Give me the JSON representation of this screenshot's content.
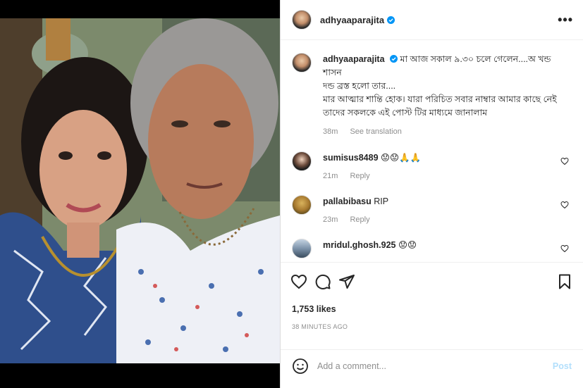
{
  "post": {
    "username": "adhyaaparajita",
    "caption_lines": [
      "মা আজ সকাল ৯.৩০ চলে গেলেন....অ খন্ড শাসন",
      "দন্ড ব্রস্ত হলো তার....",
      "মার আত্মার শান্তি হোক। যারা পরিচিত সবার নাম্বার আমার কাছে নেই",
      "তাদের সকলকে এই পোস্ট টির মাধ্যমে জানালাম"
    ],
    "caption_time": "38m",
    "see_translation": "See translation",
    "more_label": "•••"
  },
  "comments": [
    {
      "user": "sumisus8489",
      "text": "😟😟🙏🙏",
      "time": "21m",
      "reply": "Reply"
    },
    {
      "user": "pallabibasu",
      "text": "RIP",
      "time": "23m",
      "reply": "Reply"
    },
    {
      "user": "mridul.ghosh.925",
      "text": "😟😟",
      "time": "",
      "reply": ""
    }
  ],
  "likes": "1,753 likes",
  "timestamp": "38 MINUTES AGO",
  "add_comment_placeholder": "Add a comment...",
  "post_label": "Post",
  "icons": {
    "like": "heart-icon",
    "comment": "comment-icon",
    "share": "paper-plane-icon",
    "save": "bookmark-icon",
    "emoji": "smiley-icon",
    "verified": "verified-badge-icon"
  },
  "colors": {
    "verified_blue": "#0095f6",
    "post_button_disabled": "#b2dffc",
    "secondary_text": "#8e8e8e"
  }
}
